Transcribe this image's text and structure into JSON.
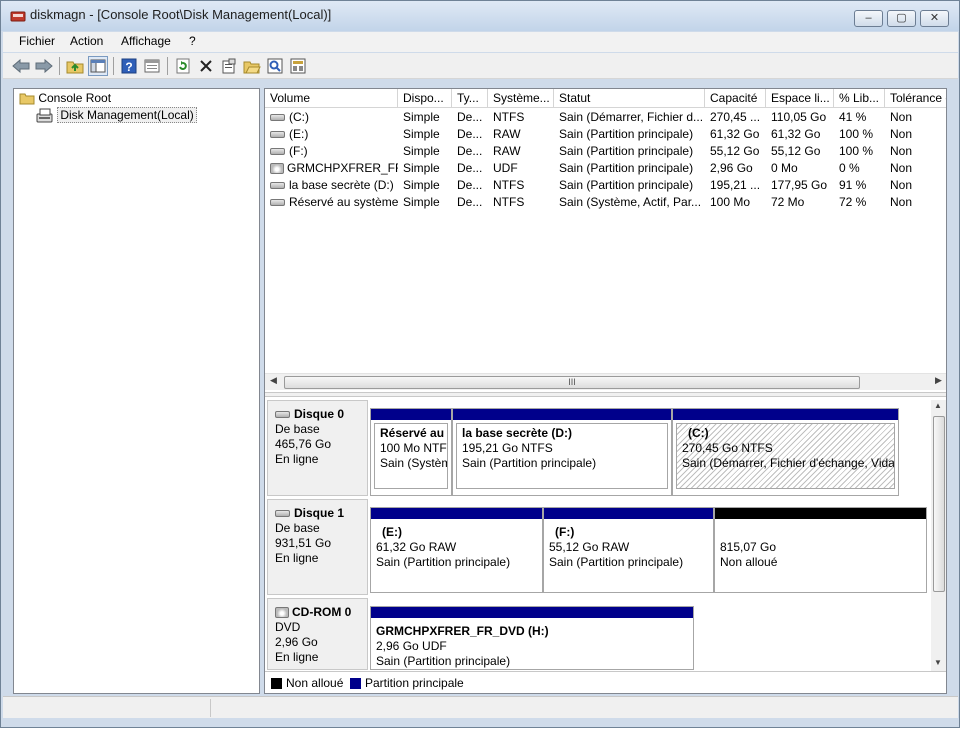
{
  "window": {
    "title": "diskmagn - [Console Root\\Disk Management(Local)]",
    "buttons": [
      "–",
      "▢",
      "✕"
    ]
  },
  "menu": [
    "Fichier",
    "Action",
    "Affichage",
    "?"
  ],
  "toolbar": {
    "icons": [
      "back-arrow-icon",
      "forward-arrow-icon",
      "up-folder-icon",
      "show-hide-tree-icon",
      "help-icon",
      "console-icon",
      "refresh-icon",
      "delete-icon",
      "properties-icon",
      "open-icon",
      "rescan-icon",
      "export-icon"
    ]
  },
  "tree": {
    "root": "Console Root",
    "child": "Disk Management(Local)"
  },
  "table": {
    "headers": [
      "Volume",
      "Dispo...",
      "Ty...",
      "Système...",
      "Statut",
      "Capacité",
      "Espace li...",
      "% Lib...",
      "Tolérance c"
    ],
    "rows": [
      [
        "(C:)",
        "Simple",
        "De...",
        "NTFS",
        "Sain (Démarrer, Fichier d...",
        "270,45 ...",
        "110,05 Go",
        "41 %",
        "Non"
      ],
      [
        "(E:)",
        "Simple",
        "De...",
        "RAW",
        "Sain (Partition principale)",
        "61,32 Go",
        "61,32 Go",
        "100 %",
        "Non"
      ],
      [
        "(F:)",
        "Simple",
        "De...",
        "RAW",
        "Sain (Partition principale)",
        "55,12 Go",
        "55,12 Go",
        "100 %",
        "Non"
      ],
      [
        "GRMCHPXFRER_FR...",
        "Simple",
        "De...",
        "UDF",
        "Sain (Partition principale)",
        "2,96 Go",
        "0 Mo",
        "0 %",
        "Non"
      ],
      [
        "la base secrète (D:)",
        "Simple",
        "De...",
        "NTFS",
        "Sain (Partition principale)",
        "195,21 ...",
        "177,95 Go",
        "91 %",
        "Non"
      ],
      [
        "Réservé au système",
        "Simple",
        "De...",
        "NTFS",
        "Sain (Système, Actif, Par...",
        "100 Mo",
        "72 Mo",
        "72 %",
        "Non"
      ]
    ]
  },
  "hscroll_grip": "III",
  "disks": [
    {
      "name": "Disque 0",
      "type": "De base",
      "size": "465,76 Go",
      "state": "En ligne",
      "partitions": [
        {
          "name": "Réservé au s",
          "size": "100 Mo NTFS",
          "status": "Sain (Systèm"
        },
        {
          "name": "la base secrète  (D:)",
          "size": "195,21 Go NTFS",
          "status": "Sain (Partition principale)"
        },
        {
          "name": "(C:)",
          "size": "270,45 Go NTFS",
          "status": "Sain (Démarrer, Fichier d'échange, Vidag"
        }
      ]
    },
    {
      "name": "Disque 1",
      "type": "De base",
      "size": "931,51 Go",
      "state": "En ligne",
      "partitions": [
        {
          "name": "(E:)",
          "size": "61,32 Go RAW",
          "status": "Sain (Partition principale)"
        },
        {
          "name": "(F:)",
          "size": "55,12 Go RAW",
          "status": "Sain (Partition principale)"
        },
        {
          "name": "",
          "size": "815,07 Go",
          "status": "Non alloué"
        }
      ]
    },
    {
      "name": "CD-ROM 0",
      "type": "DVD",
      "size": "2,96 Go",
      "state": "En ligne",
      "partitions": [
        {
          "name": "GRMCHPXFRER_FR_DVD  (H:)",
          "size": "2,96 Go UDF",
          "status": "Sain (Partition principale)"
        }
      ]
    }
  ],
  "legend": [
    {
      "label": "Non alloué",
      "color": "#000000"
    },
    {
      "label": "Partition principale",
      "color": "#00008b"
    }
  ],
  "colors": {
    "primary_partition": "#00008b",
    "unallocated": "#000000",
    "selection": "#cce8ff"
  }
}
